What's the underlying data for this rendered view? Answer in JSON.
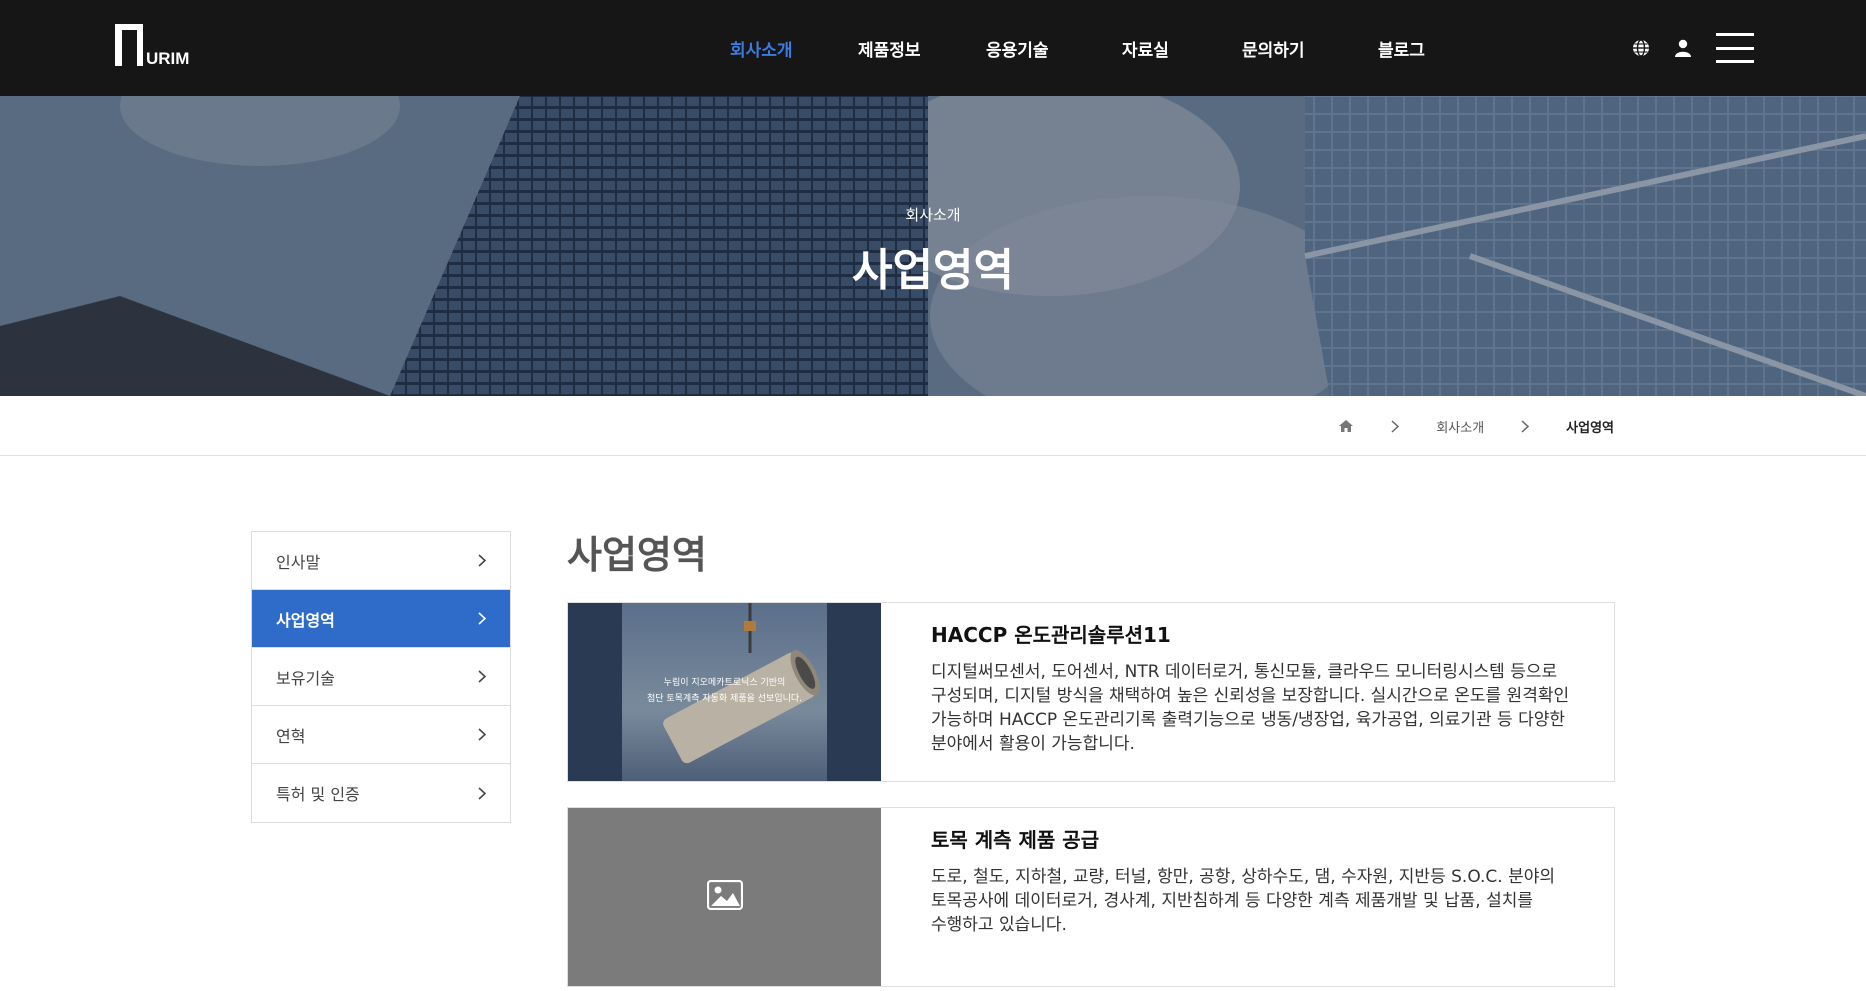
{
  "header": {
    "logo_text": "NURIM",
    "nav": [
      {
        "label": "회사소개",
        "active": true
      },
      {
        "label": "제품정보",
        "active": false
      },
      {
        "label": "응용기술",
        "active": false
      },
      {
        "label": "자료실",
        "active": false
      },
      {
        "label": "문의하기",
        "active": false
      },
      {
        "label": "블로그",
        "active": false
      }
    ],
    "icons": [
      "globe-icon",
      "user-icon",
      "hamburger-menu-icon"
    ]
  },
  "hero": {
    "subtitle": "회사소개",
    "title": "사업영역"
  },
  "breadcrumb": {
    "home_icon": "home-icon",
    "items": [
      "회사소개",
      "사업영역"
    ]
  },
  "sidebar": {
    "items": [
      {
        "label": "인사말",
        "active": false
      },
      {
        "label": "사업영역",
        "active": true
      },
      {
        "label": "보유기술",
        "active": false
      },
      {
        "label": "연혁",
        "active": false
      },
      {
        "label": "특허 및 인증",
        "active": false
      }
    ]
  },
  "main": {
    "title": "사업영역",
    "cards": [
      {
        "title": "HACCP 온도관리솔루션11",
        "description": "디지털써모센서, 도어센서, NTR 데이터로거, 통신모듈, 클라우드 모니터링시스템 등으로 구성되며, 디지털 방식을 채택하여 높은 신뢰성을 보장합니다. 실시간으로 온도를 원격확인 가능하며 HACCP 온도관리기록 출력기능으로 냉동/냉장업, 육가공업, 의료기관 등 다양한 분야에서 활용이 가능합니다.",
        "thumb_caption_line1": "누림이 지오메카트로닉스 기반의",
        "thumb_caption_line2": "첨단 토목계측 자동화 제품을 선보입니다."
      },
      {
        "title": "토목 계측 제품 공급",
        "description": "도로, 철도, 지하철, 교량, 터널, 항만, 공항, 상하수도, 댐, 수자원, 지반등 S.O.C. 분야의 토목공사에 데이터로거, 경사계, 지반침하계 등 다양한 계측 제품개발 및 납품, 설치를 수행하고 있습니다.",
        "thumb_icon": "image-placeholder-icon"
      }
    ]
  },
  "colors": {
    "header_bg": "#161616",
    "accent": "#2f6bc9",
    "nav_active": "#3d7be0"
  }
}
